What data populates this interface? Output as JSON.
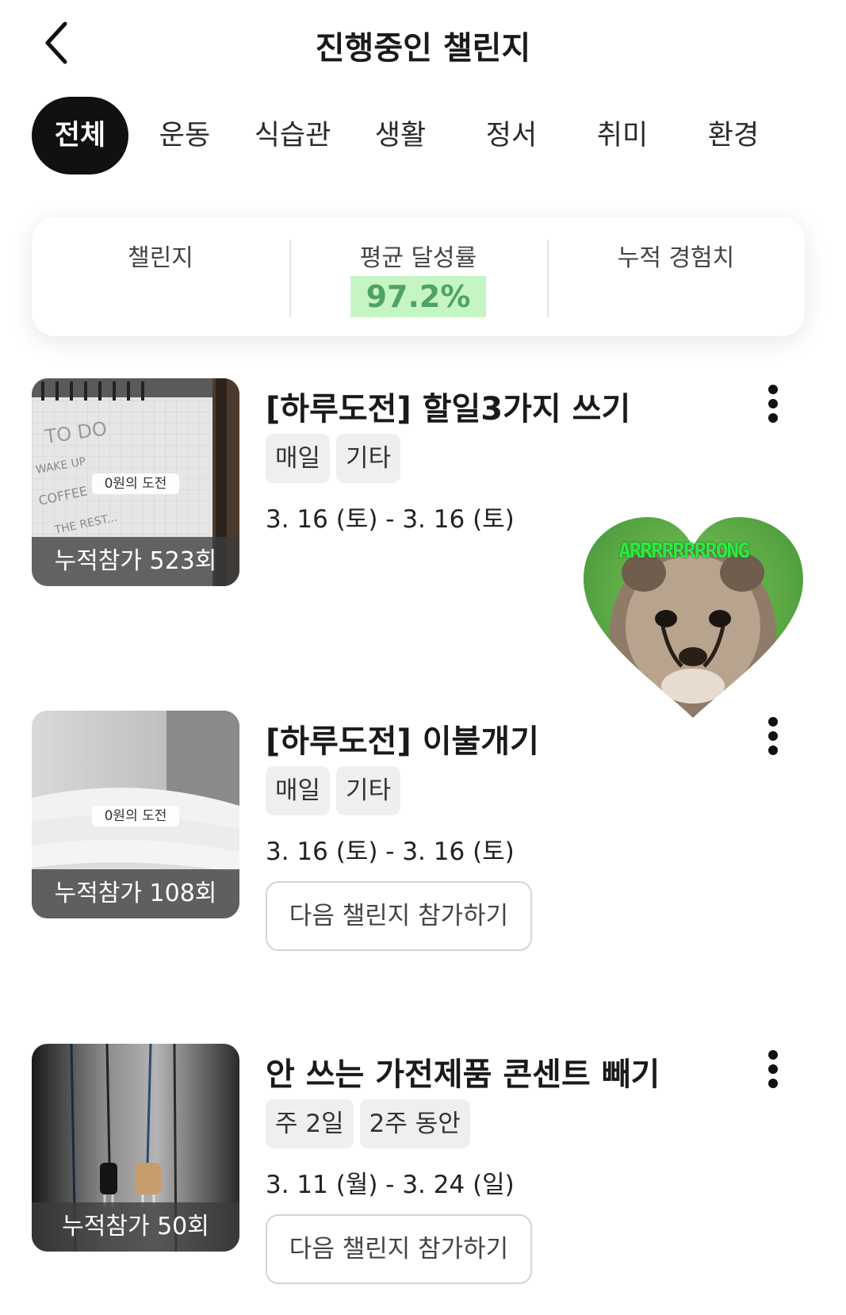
{
  "header": {
    "title": "진행중인 챌린지"
  },
  "tabs": [
    {
      "label": "전체",
      "active": true
    },
    {
      "label": "운동",
      "active": false
    },
    {
      "label": "식습관",
      "active": false
    },
    {
      "label": "생활",
      "active": false
    },
    {
      "label": "정서",
      "active": false
    },
    {
      "label": "취미",
      "active": false
    },
    {
      "label": "환경",
      "active": false
    }
  ],
  "stats": {
    "challenge_label": "챌린지",
    "avg_label": "평균 달성률",
    "avg_value": "97.2%",
    "xp_label": "누적 경험치"
  },
  "sticker": {
    "text": "ARRRRRRRRONG"
  },
  "challenges": [
    {
      "title": "[하루도전] 할일3가지 쓰기",
      "tags": [
        "매일",
        "기타"
      ],
      "dates": "3. 16 (토) - 3. 16 (토)",
      "zero_tag": "0원의 도전",
      "participants": "누적참가 523회"
    },
    {
      "title": "[하루도전] 이불개기",
      "tags": [
        "매일",
        "기타"
      ],
      "dates": "3. 16 (토) - 3. 16 (토)",
      "zero_tag": "0원의 도전",
      "participants": "누적참가 108회",
      "join_label": "다음 챌린지 참가하기"
    },
    {
      "title": "안 쓰는 가전제품 콘센트 빼기",
      "tags": [
        "주 2일",
        "2주 동안"
      ],
      "dates": "3. 11 (월) - 3. 24 (일)",
      "participants": "누적참가 50회",
      "join_label": "다음 챌린지 참가하기"
    }
  ],
  "colors": {
    "accent_green_bg": "#c6f5c5",
    "accent_green_text": "#4fa361",
    "active_tab": "#111111"
  }
}
